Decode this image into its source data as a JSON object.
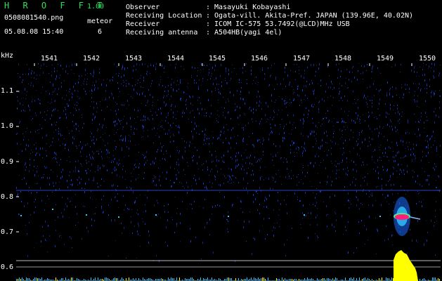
{
  "app": {
    "name": "H R O F F T",
    "version": "1.00",
    "file": "0508081540.png",
    "datetime": "05.08.08 15:40",
    "meteor_label": "meteor",
    "meteor_count": "6"
  },
  "info": {
    "rows": [
      {
        "label": "Observer",
        "value": ": Masayuki Kobayashi"
      },
      {
        "label": "Receiving Location",
        "value": ": Ogata-vill. Akita-Pref. JAPAN (139.96E, 40.02N)"
      },
      {
        "label": "Receiver",
        "value": ": ICOM IC-575 53.7492(@LCD)MHz USB"
      },
      {
        "label": "Receiving antenna",
        "value": ": A504HB(yagi 4el)"
      }
    ]
  },
  "axes": {
    "y_unit": "kHz",
    "y_ticks": [
      "1.1",
      "1.0",
      "0.9",
      "0.8",
      "0.7",
      "0.6"
    ],
    "x_ticks": [
      "1541",
      "1542",
      "1543",
      "1544",
      "1545",
      "1546",
      "1547",
      "1548",
      "1549",
      "1550"
    ]
  },
  "colors": {
    "background": "#000000",
    "noise": "#1e2ea0",
    "meteor": "#ff1e78",
    "signal": "#ffff00",
    "cyan": "#30c8ff"
  }
}
